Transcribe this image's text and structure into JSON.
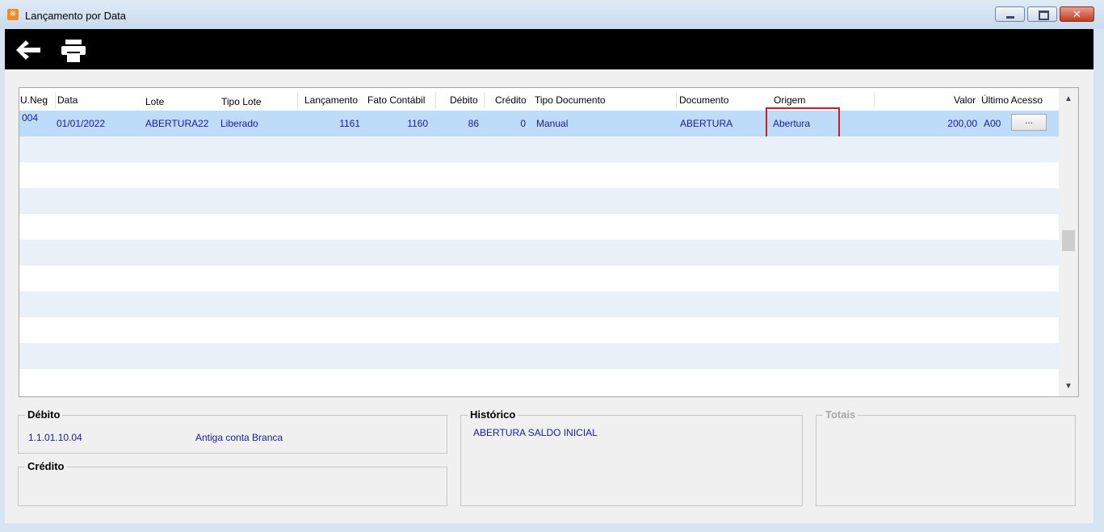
{
  "window": {
    "title": "Lançamento por Data",
    "close_glyph": "✕",
    "app_icon_glyph": "※"
  },
  "toolbar": {
    "icons": [
      "back-arrow-icon",
      "printer-icon"
    ]
  },
  "grid": {
    "columns": {
      "uneg": "U.Neg",
      "data": "Data",
      "lote": "Lote",
      "tipo_lote": "Tipo Lote",
      "lancamento": "Lançamento",
      "fato_contabil": "Fato Contábil",
      "debito": "Débito",
      "credito": "Crédito",
      "tipo_documento": "Tipo Documento",
      "documento": "Documento",
      "origem": "Origem",
      "valor": "Valor",
      "ultimo_acesso": "Último Acesso"
    },
    "row": {
      "uneg": "004",
      "data": "01/01/2022",
      "lote": "ABERTURA22",
      "tipo_lote": "Liberado",
      "lancamento": "1161",
      "fato_contabil": "1160",
      "debito": "86",
      "credito": "0",
      "tipo_documento": "Manual",
      "documento": "ABERTURA",
      "origem": "Abertura",
      "valor": "200,00",
      "ultimo_acesso": "A00",
      "button_label": "..."
    },
    "scroll_up": "▲",
    "scroll_down": "▼"
  },
  "panels": {
    "debito": {
      "label": "Débito",
      "account_code": "1.1.01.10.04",
      "account_name": "Antiga conta Branca"
    },
    "credito": {
      "label": "Crédito"
    },
    "historico": {
      "label": "Histórico",
      "text": "ABERTURA SALDO INICIAL"
    },
    "totais": {
      "label": "Totais"
    }
  },
  "colors": {
    "selection": "#bcdcfa",
    "value_text": "#1a1aa0",
    "highlight_border": "#d21b1b",
    "toolbar_bg": "#000000"
  }
}
